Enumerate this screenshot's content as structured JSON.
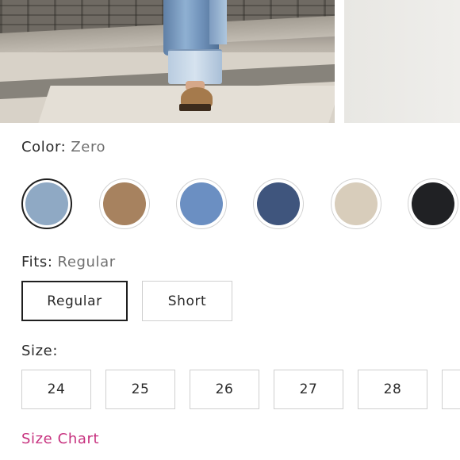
{
  "color": {
    "label": "Color:",
    "selected_value": "Zero",
    "swatches": [
      {
        "name": "light-wash-denim",
        "fill": "#8fa9c4",
        "selected": true
      },
      {
        "name": "tan-suede",
        "fill": "#a7825f",
        "selected": false
      },
      {
        "name": "medium-blue-denim",
        "fill": "#6b8fc2",
        "selected": false
      },
      {
        "name": "dark-indigo-denim",
        "fill": "#3f557d",
        "selected": false
      },
      {
        "name": "ecru",
        "fill": "#d8cdbb",
        "selected": false
      },
      {
        "name": "black-denim",
        "fill": "#202124",
        "selected": false
      }
    ]
  },
  "fits": {
    "label": "Fits:",
    "selected_value": "Regular",
    "options": [
      "Regular",
      "Short"
    ]
  },
  "size": {
    "label": "Size:",
    "options": [
      "24",
      "25",
      "26",
      "27",
      "28"
    ]
  },
  "size_chart_label": "Size Chart",
  "colors": {
    "accent_link": "#c7327f",
    "selected_border": "#1f1f1f",
    "default_border": "#cfcfcf"
  }
}
